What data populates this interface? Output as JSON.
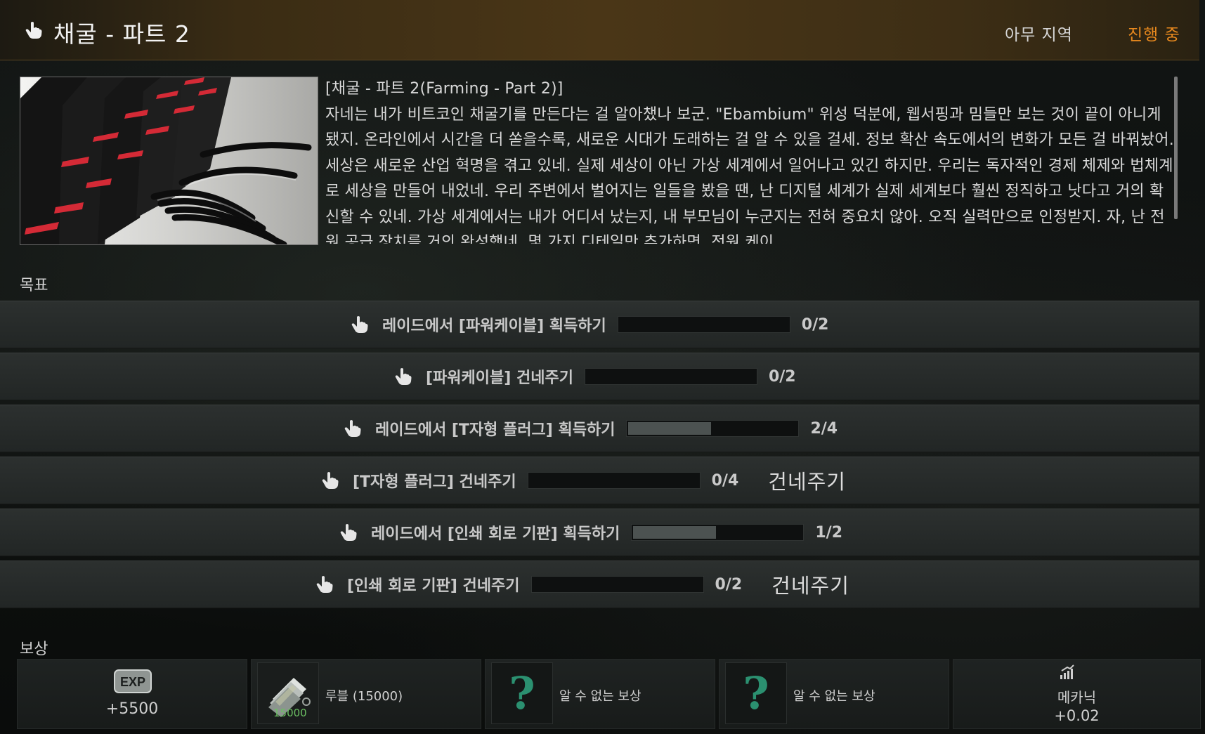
{
  "header": {
    "title": "채굴 - 파트 2",
    "location": "아무 지역",
    "status": "진행 중"
  },
  "description": {
    "text": "[채굴 - 파트 2(Farming - Part 2)]\n자네는 내가 비트코인 채굴기를 만든다는 걸 알아챘나 보군. \"Ebambium\" 위성 덕분에, 웹서핑과 밈들만 보는 것이 끝이 아니게 됐지. 온라인에서 시간을 더 쏟을수록, 새로운 시대가 도래하는 걸 알 수 있을 걸세. 정보 확산 속도에서의 변화가 모든 걸 바꿔놨어. 세상은 새로운 산업 혁명을 겪고 있네. 실제 세상이 아닌 가상 세계에서 일어나고 있긴 하지만. 우리는 독자적인 경제 체제와 법체계로 세상을 만들어 내었네. 우리 주변에서 벌어지는 일들을 봤을 땐, 난 디지털 세계가 실제 세계보다 훨씬 정직하고 낫다고 거의 확신할 수 있네. 가상 세계에서는 내가 어디서 났는지, 내 부모님이 누군지는 전혀 중요치 않아. 오직 실력만으로 인정받지. 자, 난 전원 공급 장치를 거의 완성했네. 몇 가지 디테일만 추가하면, 전원 케이"
  },
  "objectives_label": "목표",
  "objectives": [
    {
      "label": "레이드에서 [파워케이블] 획득하기",
      "count": "0/2",
      "progress": 0.0,
      "action": ""
    },
    {
      "label": "[파워케이블] 건네주기",
      "count": "0/2",
      "progress": 0.0,
      "action": ""
    },
    {
      "label": "레이드에서 [T자형 플러그] 획득하기",
      "count": "2/4",
      "progress": 0.5,
      "action": ""
    },
    {
      "label": "[T자형 플러그] 건네주기",
      "count": "0/4",
      "progress": 0.0,
      "action": "건네주기"
    },
    {
      "label": "레이드에서 [인쇄 회로 기판] 획득하기",
      "count": "1/2",
      "progress": 0.5,
      "action": ""
    },
    {
      "label": "[인쇄 회로 기판] 건네주기",
      "count": "0/2",
      "progress": 0.0,
      "action": "건네주기"
    }
  ],
  "rewards_label": "보상",
  "rewards": {
    "exp": {
      "badge": "EXP",
      "value": "+5500"
    },
    "roubles": {
      "label": "루블 (15000)",
      "stack": "15000"
    },
    "unknown1": {
      "label": "알 수 없는 보상",
      "icon": "?"
    },
    "unknown2": {
      "label": "알 수 없는 보상",
      "icon": "?"
    },
    "skill": {
      "name": "메카닉",
      "value": "+0.02"
    }
  },
  "colors": {
    "status": "#e8891e",
    "header_bg": "#4a3617",
    "unknown_icon": "#2b9070",
    "progress_fill": "#4c5251"
  }
}
